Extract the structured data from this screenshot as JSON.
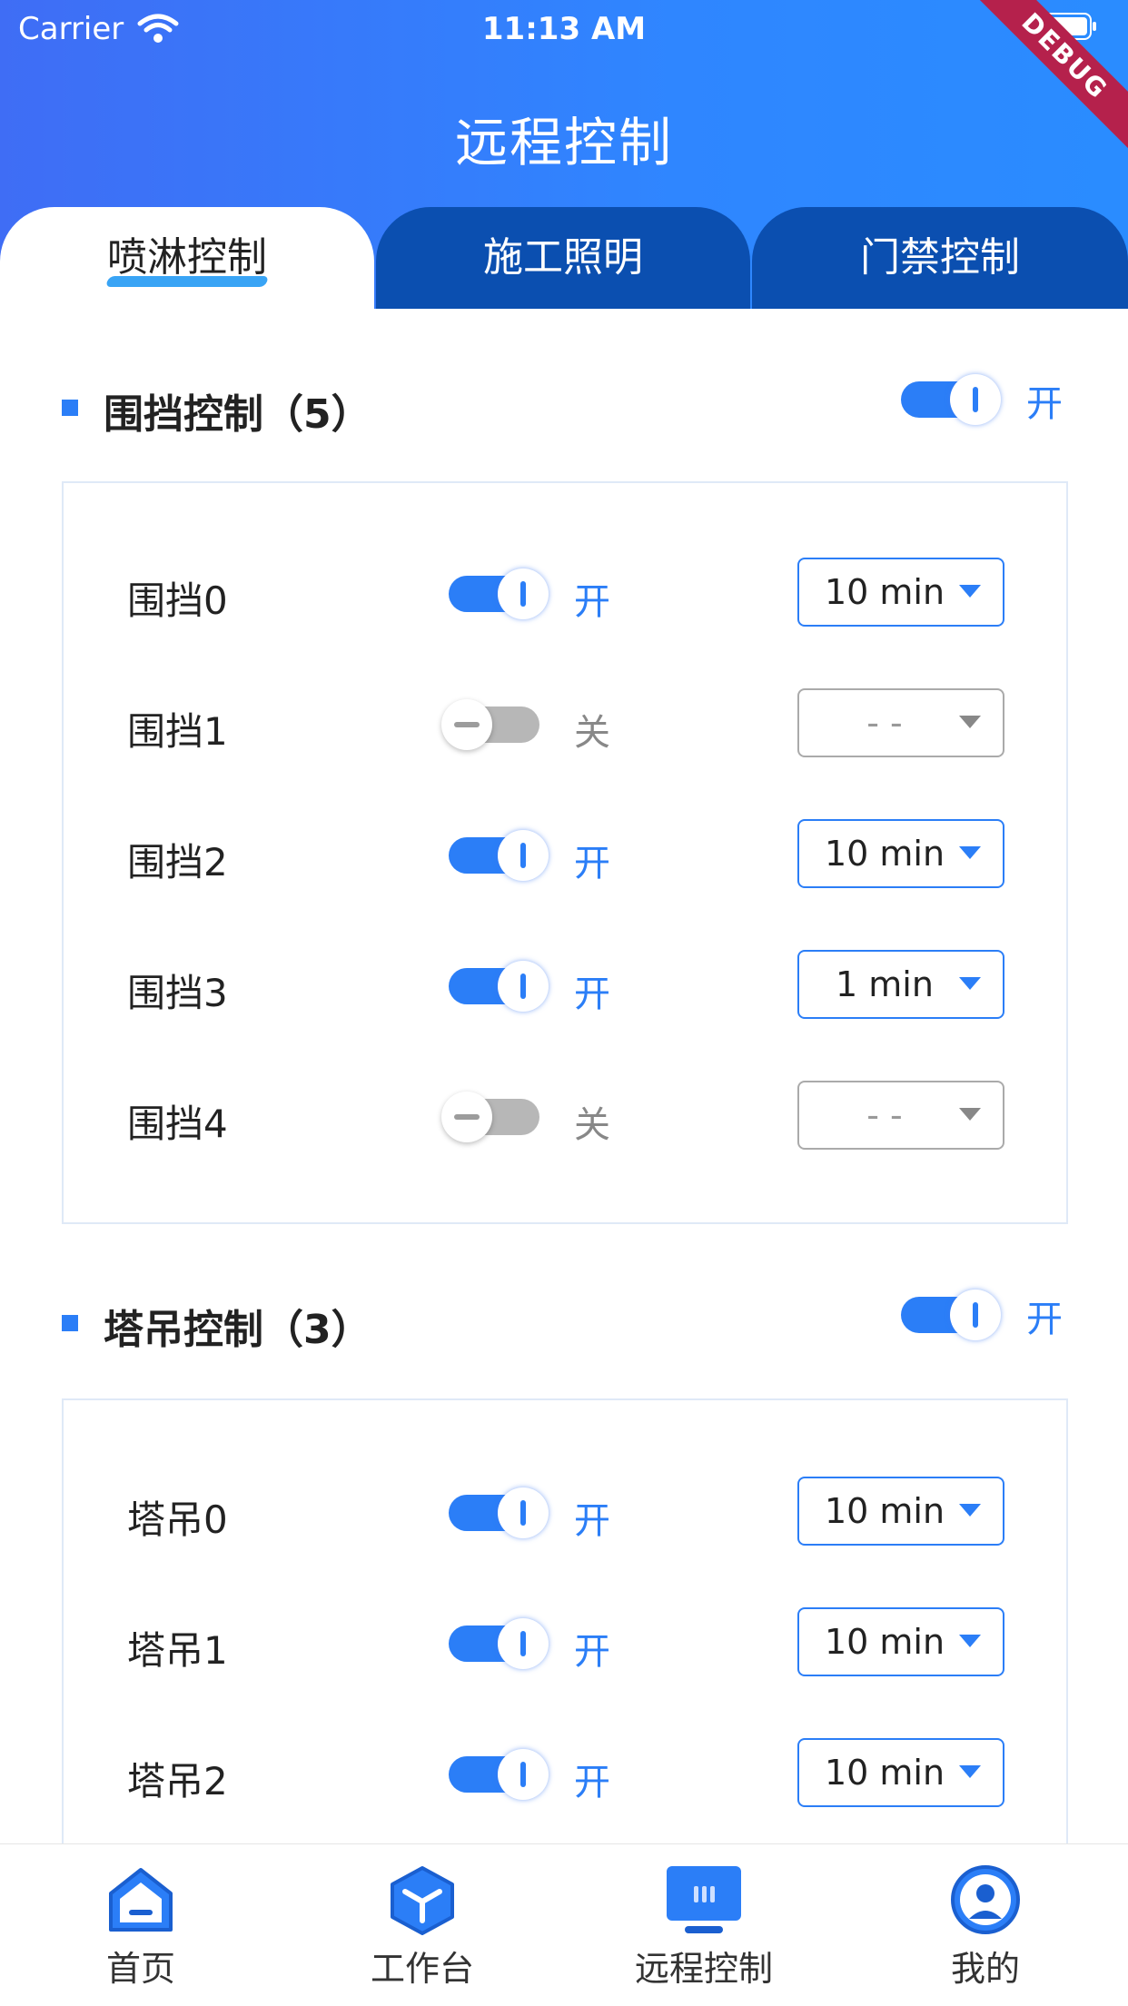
{
  "status_bar": {
    "carrier": "Carrier",
    "time": "11:13 AM"
  },
  "header": {
    "title": "远程控制",
    "debug_banner": "DEBUG"
  },
  "tabs": [
    {
      "label": "喷淋控制",
      "active": true
    },
    {
      "label": "施工照明",
      "active": false
    },
    {
      "label": "门禁控制",
      "active": false
    }
  ],
  "sections": [
    {
      "title": "围挡控制（5）",
      "master_state": "开",
      "rows": [
        {
          "name": "围挡0",
          "state": "开",
          "duration": "10 min"
        },
        {
          "name": "围挡1",
          "state": "关",
          "duration": "- -"
        },
        {
          "name": "围挡2",
          "state": "开",
          "duration": "10 min"
        },
        {
          "name": "围挡3",
          "state": "开",
          "duration": "1 min"
        },
        {
          "name": "围挡4",
          "state": "关",
          "duration": "- -"
        }
      ]
    },
    {
      "title": "塔吊控制（3）",
      "master_state": "开",
      "rows": [
        {
          "name": "塔吊0",
          "state": "开",
          "duration": "10 min"
        },
        {
          "name": "塔吊1",
          "state": "开",
          "duration": "10 min"
        },
        {
          "name": "塔吊2",
          "state": "开",
          "duration": "10 min"
        }
      ]
    }
  ],
  "bottom_nav": [
    {
      "label": "首页",
      "icon": "home-icon"
    },
    {
      "label": "工作台",
      "icon": "cube-icon"
    },
    {
      "label": "远程控制",
      "icon": "remote-control-icon",
      "active": true
    },
    {
      "label": "我的",
      "icon": "user-icon"
    }
  ],
  "colors": {
    "accent": "#2b7ef7",
    "tab_bg": "#0b4fb0",
    "debug": "#b5214c"
  }
}
